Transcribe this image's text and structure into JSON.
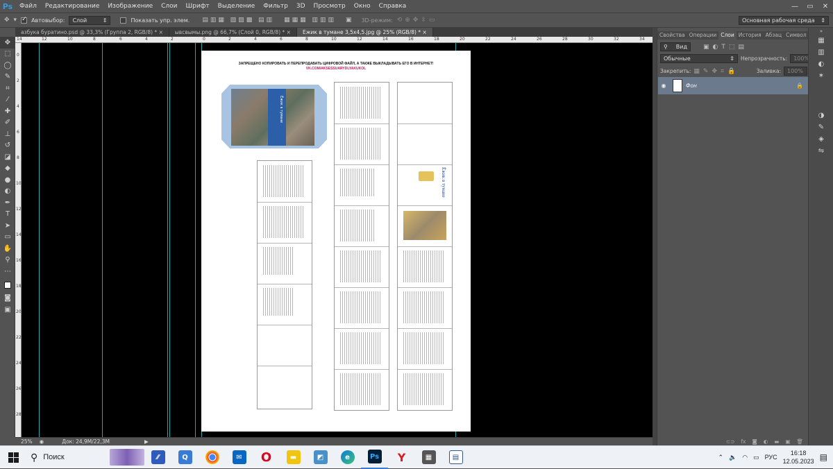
{
  "app": {
    "logo": "Ps"
  },
  "menu": [
    "Файл",
    "Редактирование",
    "Изображение",
    "Слои",
    "Шрифт",
    "Выделение",
    "Фильтр",
    "3D",
    "Просмотр",
    "Окно",
    "Справка"
  ],
  "window_controls": [
    "—",
    "▭",
    "✕"
  ],
  "options": {
    "autoselect_label": "Автовыбор:",
    "autoselect_value": "Слой",
    "show_transform_label": "Показать упр. элем.",
    "mode3d_label": "3D-режим:",
    "workspace": "Основная рабочая среда"
  },
  "tabs": [
    {
      "label": "азбука буратино.psd @ 33,3% (Группа 2, RGB/8) *",
      "active": false
    },
    {
      "label": "ывсвымы.png @ 66,7% (Слой 0, RGB/8) *",
      "active": false
    },
    {
      "label": "Ежик в тумане 3,5x4,5.jpg @ 25% (RGB/8) *",
      "active": true
    }
  ],
  "ruler_h": [
    "14",
    "12",
    "10",
    "8",
    "6",
    "4",
    "2",
    "0",
    "2",
    "4",
    "6",
    "8",
    "10",
    "12",
    "14",
    "16",
    "18",
    "20",
    "22",
    "24",
    "26",
    "28",
    "30",
    "32",
    "34"
  ],
  "ruler_v": [
    "0",
    "2",
    "4",
    "6",
    "8",
    "10",
    "12",
    "14",
    "16",
    "18",
    "20",
    "22",
    "24",
    "26",
    "28"
  ],
  "document": {
    "notice": "ЗАПРЕЩЕНО КОПИРОВАТЬ И ПЕРЕПРОДАВАТЬ ЦИФРОВОЙ ФАЙЛ, А ТАКЖЕ ВЫКЛАДЫВАТЬ ЕГО В ИНТЕРНЕТ!",
    "link": "VK.COM/AKSESSUARYDLYAKUKOL",
    "cover_title": "Ёжик в тумане",
    "page_title": "Ёжик в тумане"
  },
  "status": {
    "zoom": "25%",
    "doc": "Док: 24,9M/22,3M"
  },
  "panel": {
    "tabs": [
      "Свойства",
      "Операции",
      "Слои",
      "История",
      "Абзац",
      "Символ"
    ],
    "active_tab": "Слои",
    "filter": "Вид",
    "blend": "Обычные",
    "opacity_label": "Непрозрачность:",
    "opacity_value": "100%",
    "lock_label": "Закрепить:",
    "fill_label": "Заливка:",
    "fill_value": "100%",
    "layer_name": "Фон"
  },
  "taskbar": {
    "search_label": "Поиск",
    "lang": "РУС",
    "time": "16:18",
    "date": "12.05.2023"
  }
}
